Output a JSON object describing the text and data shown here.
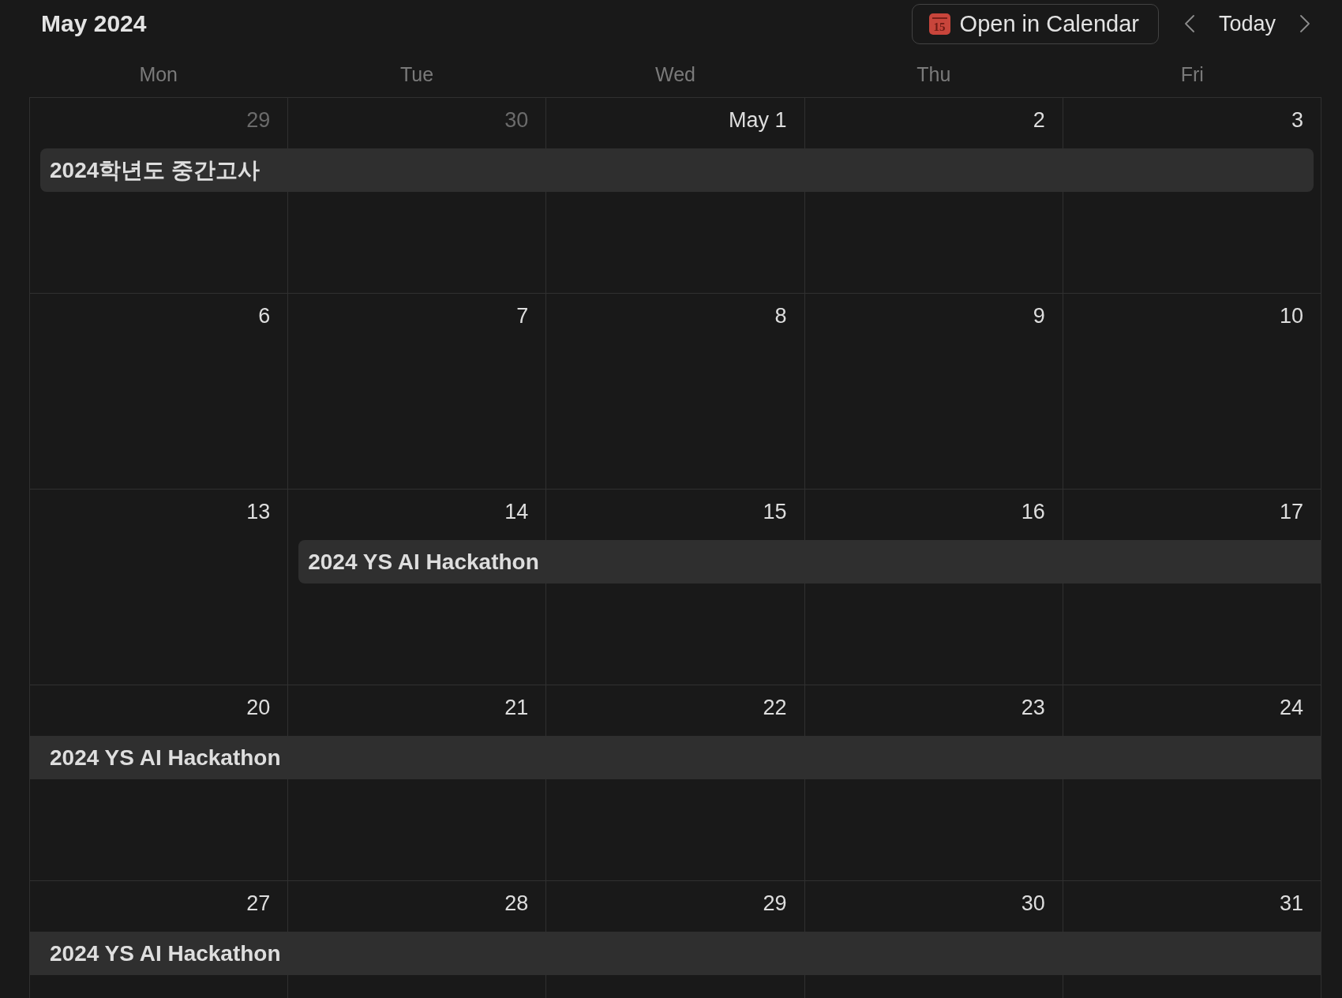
{
  "header": {
    "title": "May 2024",
    "open_button": {
      "icon_number": "15",
      "label": "Open in Calendar"
    },
    "today_button": "Today"
  },
  "weekdays": [
    "Mon",
    "Tue",
    "Wed",
    "Thu",
    "Fri"
  ],
  "weeks": [
    {
      "days": [
        {
          "date": "29",
          "in_month": false,
          "events": [
            {
              "title": "2024학년도 중간고사",
              "continues_before": false,
              "continues_after": false
            }
          ]
        },
        {
          "date": "30",
          "in_month": false
        },
        {
          "date": "May 1",
          "in_month": true
        },
        {
          "date": "2",
          "in_month": true
        },
        {
          "date": "3",
          "in_month": true
        }
      ]
    },
    {
      "days": [
        {
          "date": "6",
          "in_month": true
        },
        {
          "date": "7",
          "in_month": true
        },
        {
          "date": "8",
          "in_month": true
        },
        {
          "date": "9",
          "in_month": true
        },
        {
          "date": "10",
          "in_month": true
        }
      ]
    },
    {
      "days": [
        {
          "date": "13",
          "in_month": true
        },
        {
          "date": "14",
          "in_month": true,
          "events": [
            {
              "title": "2024 YS AI Hackathon",
              "continues_before": false,
              "continues_after": true
            }
          ]
        },
        {
          "date": "15",
          "in_month": true
        },
        {
          "date": "16",
          "in_month": true
        },
        {
          "date": "17",
          "in_month": true
        }
      ]
    },
    {
      "days": [
        {
          "date": "20",
          "in_month": true,
          "events": [
            {
              "title": "2024 YS AI Hackathon",
              "continues_before": true,
              "continues_after": true
            }
          ]
        },
        {
          "date": "21",
          "in_month": true
        },
        {
          "date": "22",
          "in_month": true
        },
        {
          "date": "23",
          "in_month": true
        },
        {
          "date": "24",
          "in_month": true
        }
      ]
    },
    {
      "days": [
        {
          "date": "27",
          "in_month": true,
          "events": [
            {
              "title": "2024 YS AI Hackathon",
              "continues_before": true,
              "continues_after": true
            }
          ]
        },
        {
          "date": "28",
          "in_month": true
        },
        {
          "date": "29",
          "in_month": true
        },
        {
          "date": "30",
          "in_month": true
        },
        {
          "date": "31",
          "in_month": true
        }
      ]
    }
  ]
}
